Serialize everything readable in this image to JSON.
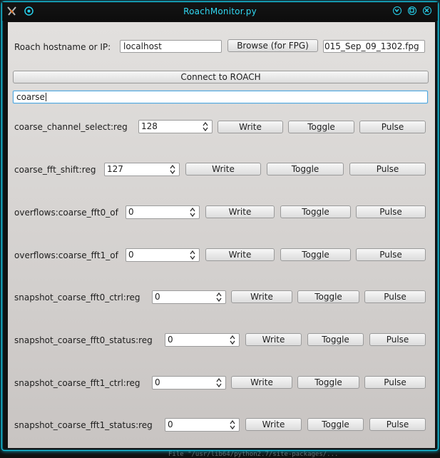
{
  "window": {
    "title": "RoachMonitor.py"
  },
  "background": {
    "top_text": "",
    "bottom_text": "File \"/usr/lib64/python2.7/site-packages/..."
  },
  "connection": {
    "host_label": "Roach hostname or IP:",
    "host_value": "localhost",
    "browse_label": "Browse (for FPG)",
    "fpg_value": "015_Sep_09_1302.fpg",
    "connect_label": "Connect to ROACH"
  },
  "filter": {
    "value": "coarse"
  },
  "action_labels": {
    "write": "Write",
    "toggle": "Toggle",
    "pulse": "Pulse"
  },
  "registers": [
    {
      "name": "coarse_channel_select:reg",
      "value": "128"
    },
    {
      "name": "coarse_fft_shift:reg",
      "value": "127"
    },
    {
      "name": "overflows:coarse_fft0_of",
      "value": "0"
    },
    {
      "name": "overflows:coarse_fft1_of",
      "value": "0"
    },
    {
      "name": "snapshot_coarse_fft0_ctrl:reg",
      "value": "0"
    },
    {
      "name": "snapshot_coarse_fft0_status:reg",
      "value": "0"
    },
    {
      "name": "snapshot_coarse_fft1_ctrl:reg",
      "value": "0"
    },
    {
      "name": "snapshot_coarse_fft1_status:reg",
      "value": "0"
    }
  ]
}
